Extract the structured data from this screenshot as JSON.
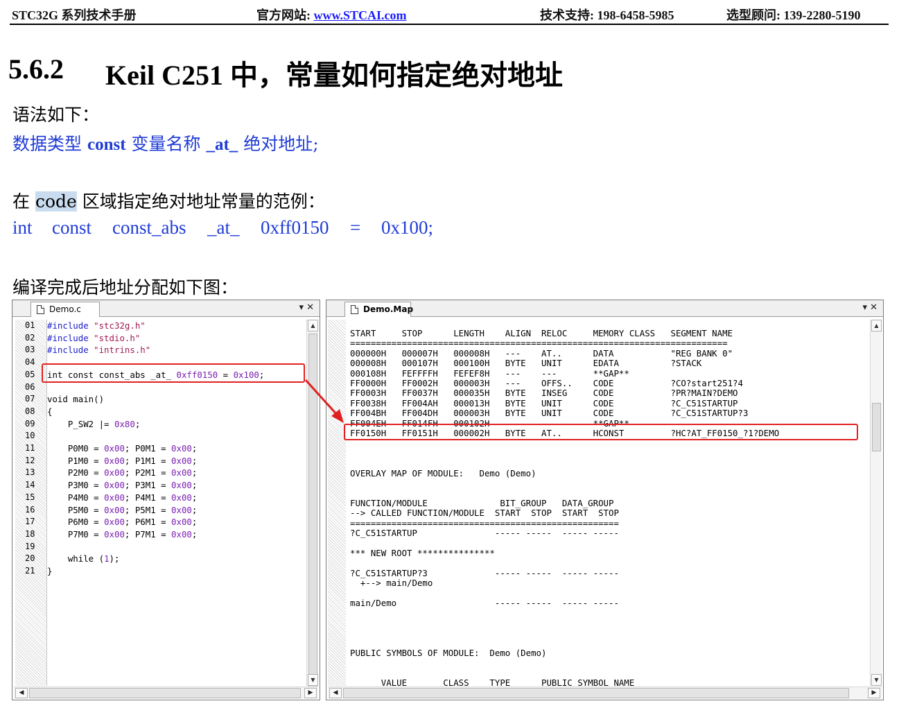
{
  "header": {
    "manual": "STC32G 系列技术手册",
    "site_label": "官方网站: ",
    "site_url": "www.STCAI.com",
    "support": "技术支持: 198-6458-5985",
    "advisor": "选型顾问: 139-2280-5190"
  },
  "section": {
    "number": "5.6.2",
    "title": "Keil C251 中，常量如何指定绝对地址"
  },
  "syntax_intro": "语法如下：",
  "syntax": {
    "type": "数据类型",
    "const": "const",
    "name": "变量名称",
    "at": "_at_",
    "addr": "绝对地址;"
  },
  "example_intro": {
    "pre": "在 ",
    "code": "code",
    "post": " 区域指定绝对地址常量的范例："
  },
  "example": {
    "t1": "int",
    "t2": "const",
    "t3": "const_abs",
    "t4": "_at_",
    "t5": "0xff0150",
    "t6": "=",
    "t7": "0x100;"
  },
  "result_intro": "编译完成后地址分配如下图：",
  "left_pane": {
    "tab": "Demo.c",
    "controls": "▾ ✕",
    "lines": [
      {
        "n": "01",
        "parts": [
          [
            "kw-pre",
            "#include "
          ],
          [
            "str",
            "\"stc32g.h\""
          ]
        ]
      },
      {
        "n": "02",
        "parts": [
          [
            "kw-pre",
            "#include "
          ],
          [
            "str",
            "\"stdio.h\""
          ]
        ]
      },
      {
        "n": "03",
        "parts": [
          [
            "kw-pre",
            "#include "
          ],
          [
            "str",
            "\"intrins.h\""
          ]
        ]
      },
      {
        "n": "04",
        "parts": []
      },
      {
        "n": "05",
        "parts": [
          [
            "plain",
            "int const const_abs _at_ "
          ],
          [
            "num",
            "0xff0150"
          ],
          [
            "plain",
            " = "
          ],
          [
            "num",
            "0x100"
          ],
          [
            "plain",
            ";"
          ]
        ]
      },
      {
        "n": "06",
        "parts": []
      },
      {
        "n": "07",
        "parts": [
          [
            "plain",
            "void main()"
          ]
        ]
      },
      {
        "n": "08",
        "parts": [
          [
            "plain",
            "{"
          ]
        ]
      },
      {
        "n": "09",
        "parts": [
          [
            "plain",
            "    P_SW2 |= "
          ],
          [
            "num",
            "0x80"
          ],
          [
            "plain",
            ";"
          ]
        ]
      },
      {
        "n": "10",
        "parts": []
      },
      {
        "n": "11",
        "parts": [
          [
            "plain",
            "    P0M0 = "
          ],
          [
            "num",
            "0x00"
          ],
          [
            "plain",
            "; P0M1 = "
          ],
          [
            "num",
            "0x00"
          ],
          [
            "plain",
            ";"
          ]
        ]
      },
      {
        "n": "12",
        "parts": [
          [
            "plain",
            "    P1M0 = "
          ],
          [
            "num",
            "0x00"
          ],
          [
            "plain",
            "; P1M1 = "
          ],
          [
            "num",
            "0x00"
          ],
          [
            "plain",
            ";"
          ]
        ]
      },
      {
        "n": "13",
        "parts": [
          [
            "plain",
            "    P2M0 = "
          ],
          [
            "num",
            "0x00"
          ],
          [
            "plain",
            "; P2M1 = "
          ],
          [
            "num",
            "0x00"
          ],
          [
            "plain",
            ";"
          ]
        ]
      },
      {
        "n": "14",
        "parts": [
          [
            "plain",
            "    P3M0 = "
          ],
          [
            "num",
            "0x00"
          ],
          [
            "plain",
            "; P3M1 = "
          ],
          [
            "num",
            "0x00"
          ],
          [
            "plain",
            ";"
          ]
        ]
      },
      {
        "n": "15",
        "parts": [
          [
            "plain",
            "    P4M0 = "
          ],
          [
            "num",
            "0x00"
          ],
          [
            "plain",
            "; P4M1 = "
          ],
          [
            "num",
            "0x00"
          ],
          [
            "plain",
            ";"
          ]
        ]
      },
      {
        "n": "16",
        "parts": [
          [
            "plain",
            "    P5M0 = "
          ],
          [
            "num",
            "0x00"
          ],
          [
            "plain",
            "; P5M1 = "
          ],
          [
            "num",
            "0x00"
          ],
          [
            "plain",
            ";"
          ]
        ]
      },
      {
        "n": "17",
        "parts": [
          [
            "plain",
            "    P6M0 = "
          ],
          [
            "num",
            "0x00"
          ],
          [
            "plain",
            "; P6M1 = "
          ],
          [
            "num",
            "0x00"
          ],
          [
            "plain",
            ";"
          ]
        ]
      },
      {
        "n": "18",
        "parts": [
          [
            "plain",
            "    P7M0 = "
          ],
          [
            "num",
            "0x00"
          ],
          [
            "plain",
            "; P7M1 = "
          ],
          [
            "num",
            "0x00"
          ],
          [
            "plain",
            ";"
          ]
        ]
      },
      {
        "n": "19",
        "parts": []
      },
      {
        "n": "20",
        "parts": [
          [
            "plain",
            "    while ("
          ],
          [
            "num",
            "1"
          ],
          [
            "plain",
            ");"
          ]
        ]
      },
      {
        "n": "21",
        "parts": [
          [
            "plain",
            "}"
          ]
        ]
      }
    ]
  },
  "right_pane": {
    "tab": "Demo.Map",
    "controls": "▾ ✕",
    "lines": [
      "START     STOP      LENGTH    ALIGN  RELOC     MEMORY CLASS   SEGMENT NAME",
      "=========================================================================",
      "000000H   000007H   000008H   ---    AT..      DATA           \"REG BANK 0\"",
      "000008H   000107H   000100H   BYTE   UNIT      EDATA          ?STACK",
      "000108H   FEFFFFH   FEFEF8H   ---    ---       **GAP**",
      "FF0000H   FF0002H   000003H   ---    OFFS..    CODE           ?CO?start251?4",
      "FF0003H   FF0037H   000035H   BYTE   INSEG     CODE           ?PR?MAIN?DEMO",
      "FF0038H   FF004AH   000013H   BYTE   UNIT      CODE           ?C_C51STARTUP",
      "FF004BH   FF004DH   000003H   BYTE   UNIT      CODE           ?C_C51STARTUP?3",
      "FF004EH   FF014FH   000102H                    **GAP**",
      "FF0150H   FF0151H   000002H   BYTE   AT..      HCONST         ?HC?AT_FF0150_?1?DEMO",
      "",
      "",
      "",
      "OVERLAY MAP OF MODULE:   Demo (Demo)",
      "",
      "",
      "FUNCTION/MODULE              BIT_GROUP   DATA_GROUP",
      "--> CALLED FUNCTION/MODULE  START  STOP  START  STOP",
      "====================================================",
      "?C_C51STARTUP               ----- -----  ----- -----",
      "",
      "*** NEW ROOT ***************",
      "",
      "?C_C51STARTUP?3             ----- -----  ----- -----",
      "  +--> main/Demo",
      "",
      "main/Demo                   ----- -----  ----- -----",
      "",
      "",
      "",
      "",
      "PUBLIC SYMBOLS OF MODULE:  Demo (Demo)",
      "",
      "",
      "      VALUE       CLASS    TYPE      PUBLIC SYMBOL NAME",
      "      ================================================="
    ]
  },
  "colors": {
    "highlight_box": "#e02020",
    "text_blue": "#1f3bd6"
  }
}
